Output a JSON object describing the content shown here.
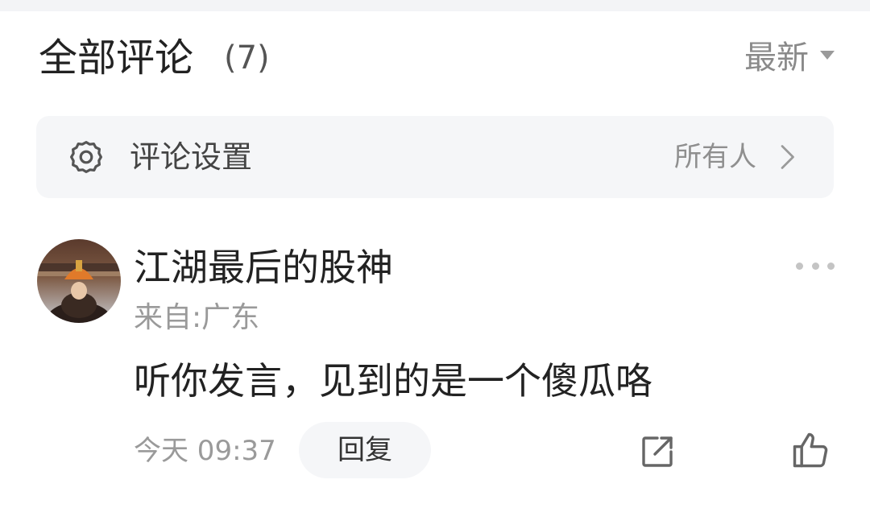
{
  "header": {
    "title": "全部评论",
    "count": "(7)",
    "sort_label": "最新",
    "sort_icon": "caret-down-icon"
  },
  "settings": {
    "label": "评论设置",
    "value": "所有人",
    "icon": "gear-icon",
    "chevron_icon": "chevron-right-icon"
  },
  "comment": {
    "username": "江湖最后的股神",
    "location": "来自:广东",
    "text": "听你发言，见到的是一个傻瓜咯",
    "time": "今天 09:37",
    "reply_label": "回复",
    "more_icon": "more-dots-icon",
    "share_icon": "share-icon",
    "like_icon": "thumbs-up-icon"
  },
  "colors": {
    "background": "#ffffff",
    "panel": "#f5f6f8",
    "primary_text": "#222222",
    "secondary_text": "#9a9a9a"
  }
}
